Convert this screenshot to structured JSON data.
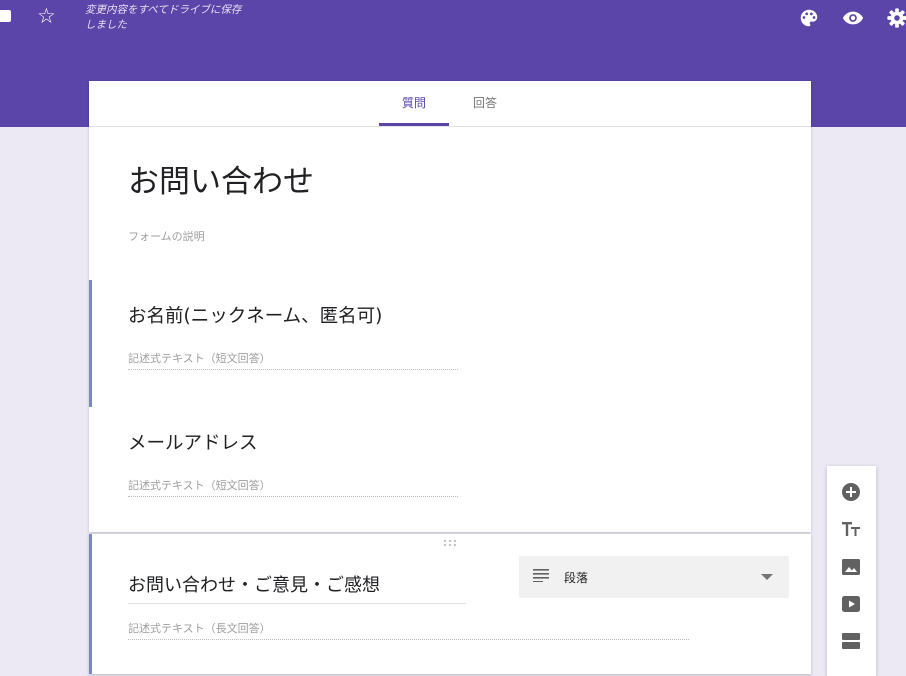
{
  "header": {
    "save_status": "変更内容をすべてドライブに保存しました",
    "icons": [
      "folder-icon",
      "star-icon",
      "palette-icon",
      "preview-eye-icon",
      "settings-gear-icon"
    ],
    "accent_color": "#5c45a8"
  },
  "tabs": [
    {
      "label": "質問",
      "active": true
    },
    {
      "label": "回答",
      "active": false
    }
  ],
  "form": {
    "title": "お問い合わせ",
    "description_placeholder": "フォームの説明"
  },
  "questions": [
    {
      "title": "お名前(ニックネーム、匿名可)",
      "answer_placeholder": "記述式テキスト（短文回答）"
    },
    {
      "title": "メールアドレス",
      "answer_placeholder": "記述式テキスト（短文回答）"
    },
    {
      "title": "お問い合わせ・ご意見・ご感想",
      "answer_placeholder": "記述式テキスト（長文回答）",
      "type": "段落"
    }
  ],
  "side_toolbar": [
    "add-question-icon",
    "add-title-icon",
    "add-image-icon",
    "add-video-icon",
    "add-section-icon"
  ]
}
